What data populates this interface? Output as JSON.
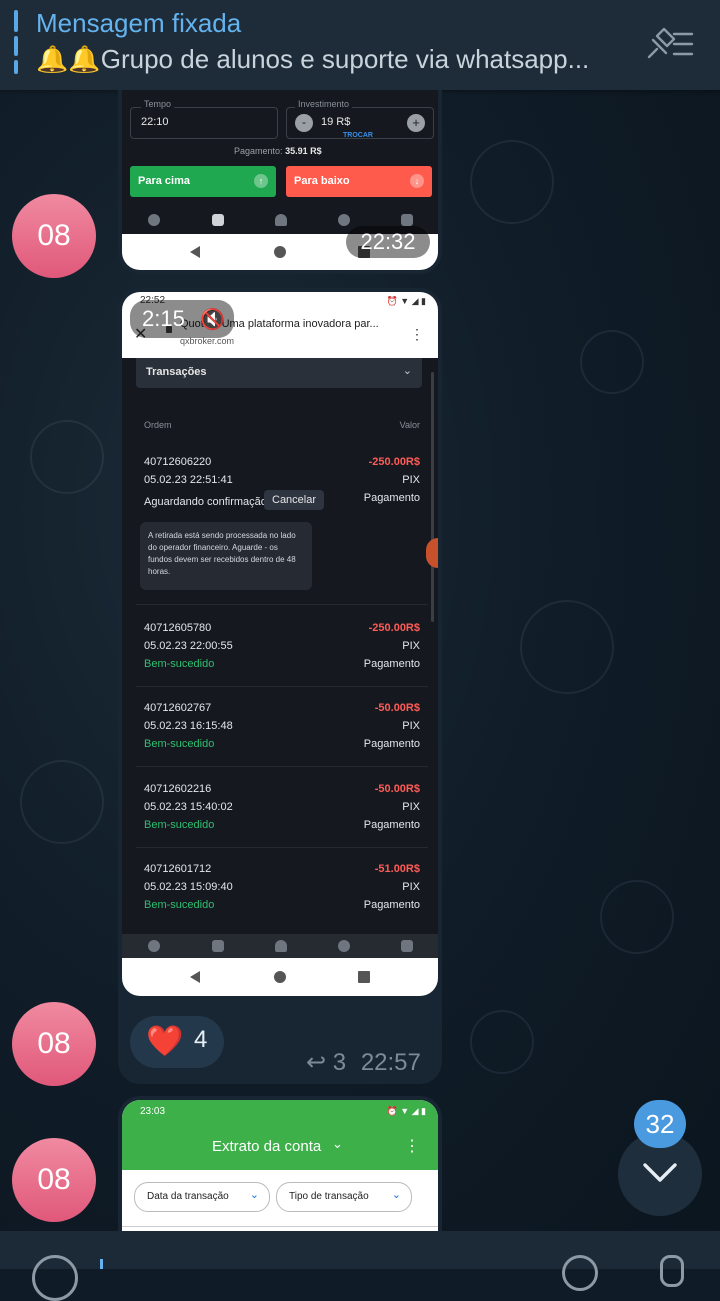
{
  "pinned": {
    "title": "Mensagem fixada",
    "text": "🔔🔔Grupo de alunos e suporte via whatsapp..."
  },
  "avatars": [
    "08",
    "08",
    "08"
  ],
  "message1": {
    "time": "22:32",
    "trade_form": {
      "tempo_label": "Tempo",
      "tempo_value": "22:10",
      "invest_label": "Investimento",
      "invest_value": "19 R$",
      "minus": "-",
      "plus": "+",
      "trocar": "TROCAR",
      "payment_label": "Pagamento:",
      "payment_value": "35.91 R$",
      "up_label": "Para cima",
      "down_label": "Para baixo"
    }
  },
  "message2": {
    "video_duration": "2:15",
    "status_time": "22:52",
    "browser_title": "Quotex: Uma plataforma inovadora par...",
    "browser_url": "qxbroker.com",
    "section_title": "Transações",
    "col_order": "Ordem",
    "col_value": "Valor",
    "transactions": [
      {
        "order": "40712606220",
        "date": "05.02.23 22:51:41",
        "status": "Aguardando confirmação",
        "amount": "-250.00R$",
        "method": "PIX",
        "type": "Pagamento"
      },
      {
        "order": "40712605780",
        "date": "05.02.23 22:00:55",
        "status": "Bem-sucedido",
        "amount": "-250.00R$",
        "method": "PIX",
        "type": "Pagamento"
      },
      {
        "order": "40712602767",
        "date": "05.02.23 16:15:48",
        "status": "Bem-sucedido",
        "amount": "-50.00R$",
        "method": "PIX",
        "type": "Pagamento"
      },
      {
        "order": "40712602216",
        "date": "05.02.23 15:40:02",
        "status": "Bem-sucedido",
        "amount": "-50.00R$",
        "method": "PIX",
        "type": "Pagamento"
      },
      {
        "order": "40712601712",
        "date": "05.02.23 15:09:40",
        "status": "Bem-sucedido",
        "amount": "-51.00R$",
        "method": "PIX",
        "type": "Pagamento"
      }
    ],
    "cancel_label": "Cancelar",
    "info_text": "A retirada está sendo processada no lado do operador financeiro. Aguarde - os fundos devem ser recebidos dentro de 48 horas.",
    "reaction_emoji": "❤️",
    "reaction_count": "4",
    "replies_count": "3",
    "time": "22:57"
  },
  "message3": {
    "status_time": "23:03",
    "header_title": "Extrato da conta",
    "filter1": "Data da transação",
    "filter2": "Tipo de transação"
  },
  "scroll_badge": "32",
  "colors": {
    "accent": "#64b3ee",
    "avatar": "#e8678a",
    "green": "#1fa84f",
    "red": "#ff5b4d",
    "bg": "#0f1b26"
  }
}
